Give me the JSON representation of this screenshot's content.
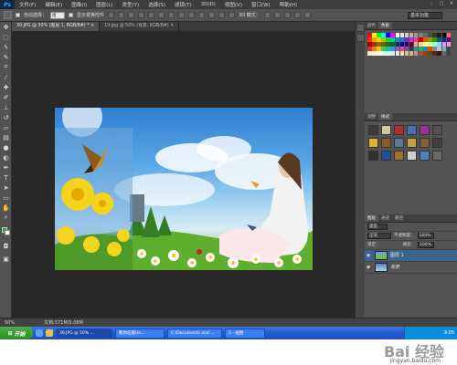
{
  "app": {
    "logo": "Ps",
    "menu": [
      "文件(F)",
      "编辑(E)",
      "图像(I)",
      "图层(L)",
      "类型(Y)",
      "选择(S)",
      "滤镜(T)",
      "3D(D)",
      "视图(V)",
      "窗口(W)",
      "帮助(H)"
    ],
    "window_controls": [
      "–",
      "□",
      "×"
    ]
  },
  "options": {
    "auto_select_label": "自动选择：",
    "auto_select_value": "组",
    "show_transform_label": "显示变换控件",
    "mode_3d_label": "3D 模式：",
    "workspace": "基本功能"
  },
  "tabs": [
    {
      "label": "30.JPG @ 50% (图层 1, RGB/8#) *  ×",
      "active": true
    },
    {
      "label": "19.jpg @ 50% (背景, RGB/8#)  ×",
      "active": false
    }
  ],
  "status": {
    "zoom": "50%",
    "doc_size": "文档:571M/5.08M"
  },
  "taskbar": {
    "start_label": "开始",
    "items": [
      {
        "label": "30.JPG @ 50% ...",
        "active": true
      },
      {
        "label": "教你征服Ue..."
      },
      {
        "label": "C:\\Documents and ..."
      },
      {
        "label": "5 - 画图"
      }
    ],
    "clock": "9:05"
  },
  "panels": {
    "color_tabs": [
      "颜色",
      "色板"
    ],
    "style_tabs": [
      "调整",
      "样式"
    ],
    "layer_tabs": [
      "图层",
      "通道",
      "路径"
    ],
    "filter_label": "类型",
    "blend_mode": "正常",
    "opacity_label": "不透明度：",
    "opacity_value": "100%",
    "lock_label": "锁定：",
    "fill_label": "填充：",
    "fill_value": "100%",
    "layers": [
      {
        "name": "图层 1",
        "active": true,
        "italic": false
      },
      {
        "name": "背景",
        "active": false,
        "italic": true
      }
    ]
  },
  "watermark": {
    "logo_text": "Bai 经验",
    "url": "jingyan.baidu.com"
  },
  "colors": {
    "foreground": "#1ea83b",
    "background": "#ffffff",
    "swatches": [
      "#ff0000",
      "#ffff00",
      "#00ff00",
      "#00ffff",
      "#0000ff",
      "#ff00ff",
      "#ffffff",
      "#e6e6e6",
      "#cccccc",
      "#b3b3b3",
      "#999999",
      "#808080",
      "#666666",
      "#4d4d4d",
      "#333333",
      "#1a1a1a",
      "#000000",
      "#ff6666",
      "#ff3300",
      "#ff9900",
      "#ffcc00",
      "#99cc00",
      "#33cc33",
      "#00cc99",
      "#0099cc",
      "#3366ff",
      "#6633cc",
      "#cc33cc",
      "#ff3399",
      "#cc0000",
      "#cc6600",
      "#999900",
      "#339900",
      "#006666",
      "#003399",
      "#660099",
      "#990000",
      "#993300",
      "#996600",
      "#666600",
      "#336600",
      "#006633",
      "#003366",
      "#000099",
      "#330066",
      "#660033",
      "#ff9999",
      "#ffcc99",
      "#ffff99",
      "#ccff99",
      "#99ffcc",
      "#99ccff",
      "#cc99ff",
      "#ff99cc",
      "#c0392b",
      "#e67e22",
      "#f1c40f",
      "#2ecc71",
      "#1abc9c",
      "#3498db",
      "#9b59b6",
      "#e84393",
      "#8e44ad",
      "#2c3e50",
      "#16a085",
      "#27ae60",
      "#2980b9",
      "#d35400",
      "#7f8c8d",
      "#bdc3c7",
      "#95a5a6",
      "#34495e",
      "#ffe0e0",
      "#ffefd5",
      "#fffacd",
      "#e0ffe0",
      "#e0ffff",
      "#e0e0ff",
      "#ffe0ff",
      "#f5deb3",
      "#deb887",
      "#d2b48c",
      "#bc8f8f",
      "#a0522d",
      "#8b4513",
      "#6b4226",
      "#4a2f1a",
      "#2e1c10",
      "#6a6a6a",
      "#454545"
    ],
    "styles": [
      "#3d3d3d",
      "#d4c7a0",
      "#b03030",
      "#4a6fb0",
      "#a03090",
      "#505050",
      "#e0b030",
      "#8a5a30",
      "#607890",
      "#c8a040",
      "#806040",
      "#404040",
      "#303030",
      "#2050a0",
      "#a07030",
      "#d0d0d0",
      "#5080c0",
      "#6a6a6a"
    ]
  }
}
